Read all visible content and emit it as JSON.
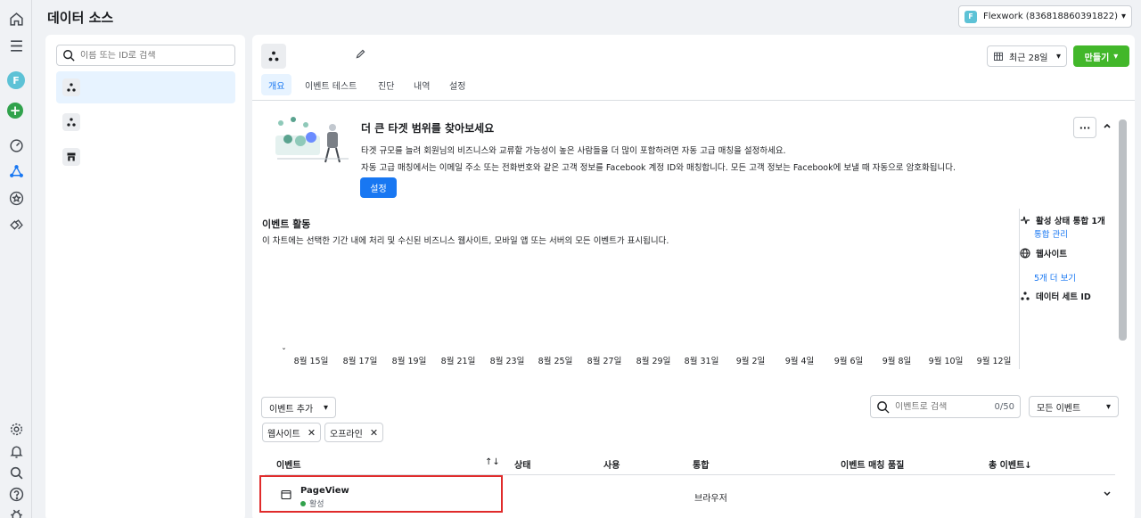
{
  "page_title": "데이터 소스",
  "account": {
    "badge": "F",
    "label": "Flexwork (836818860391822)"
  },
  "rail": {
    "avatar_letter": "F",
    "add_symbol": "+"
  },
  "left_panel": {
    "search_placeholder": "이름 또는 ID로 검색"
  },
  "main": {
    "tabs": [
      "개요",
      "이벤트 테스트",
      "진단",
      "내역",
      "설정"
    ],
    "active_tab": "개요",
    "date_range": "최근 28일",
    "create_label": "만들기"
  },
  "banner": {
    "title": "더 큰 타겟 범위를 찾아보세요",
    "line1": "타겟 규모를 늘려 회원님의 비즈니스와 교류할 가능성이 높은 사람들을 더 많이 포함하려면 자동 고급 매칭을 설정하세요.",
    "line2": "자동 고급 매칭에서는 이메일 주소 또는 전화번호와 같은 고객 정보를 Facebook 계정 ID와 매칭합니다. 모든 고객 정보는 Facebook에 보낼 때 자동으로 암호화됩니다.",
    "button": "설정",
    "more": "···"
  },
  "activity": {
    "title": "이벤트 활동",
    "description": "이 차트에는 선택한 기간 내에 처리 및 수신된 비즈니스 웹사이트, 모바일 앱 또는 서버의 모든 이벤트가 표시됩니다.",
    "x_ticks": [
      "8월 15일",
      "8월 17일",
      "8월 19일",
      "8월 21일",
      "8월 23일",
      "8월 25일",
      "8월 27일",
      "8월 29일",
      "8월 31일",
      "9월 2일",
      "9월 4일",
      "9월 6일",
      "9월 8일",
      "9월 10일",
      "9월 12일"
    ]
  },
  "info": {
    "integrations": "활성 상태 통합 1개",
    "manage": "통합 관리",
    "website": "웹사이트",
    "see_more": "5개 더 보기",
    "dataset_id": "데이터 세트 ID"
  },
  "events": {
    "add_label": "이벤트 추가",
    "search_placeholder": "이벤트로 검색",
    "search_count": "0/50",
    "filter": "모든 이벤트",
    "chips": [
      "웹사이트",
      "오프라인"
    ],
    "columns": {
      "event": "이벤트",
      "status": "상태",
      "usage": "사용",
      "integration": "통합",
      "match_quality": "이벤트 매칭 품질",
      "total": "총 이벤트↓"
    },
    "sort_icon": "↑↓",
    "rows": [
      {
        "name": "PageView",
        "status": "활성",
        "integration": "브라우저"
      }
    ]
  }
}
